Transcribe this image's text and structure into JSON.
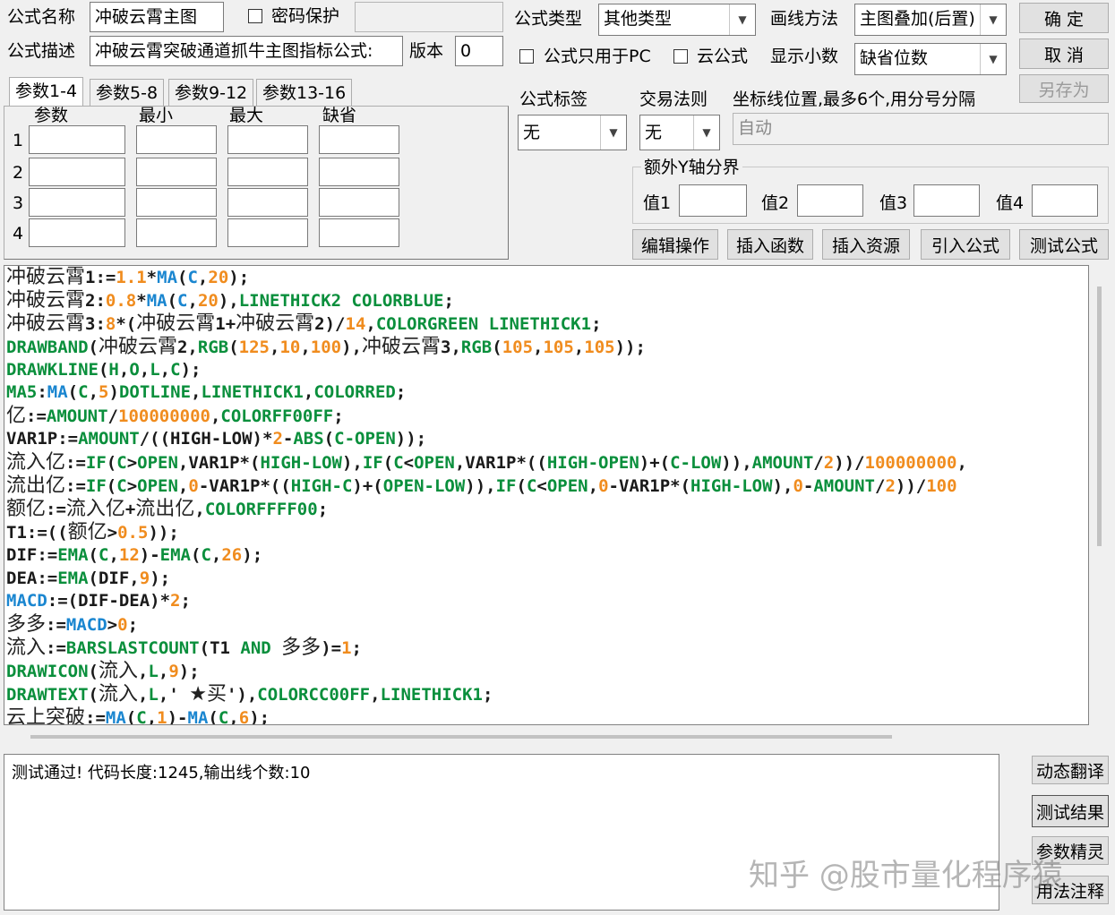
{
  "header": {
    "name_label": "公式名称",
    "name_value": "冲破云霄主图",
    "password_label": "密码保护",
    "desc_label": "公式描述",
    "desc_value": "冲破云霄突破通道抓牛主图指标公式:",
    "version_label": "版本",
    "version_value": "0",
    "type_label": "公式类型",
    "type_value": "其他类型",
    "draw_label": "画线方法",
    "draw_value": "主图叠加(后置)",
    "pc_only_label": "公式只用于PC",
    "cloud_label": "云公式",
    "decimal_label": "显示小数",
    "decimal_value": "缺省位数"
  },
  "buttons": {
    "ok": "确 定",
    "cancel": "取 消",
    "save_as": "另存为",
    "edit_ops": "编辑操作",
    "insert_func": "插入函数",
    "insert_res": "插入资源",
    "import_formula": "引入公式",
    "test_formula": "测试公式",
    "dynamic_translate": "动态翻译",
    "test_result": "测试结果",
    "param_wizard": "参数精灵",
    "usage_notes": "用法注释"
  },
  "tabs": [
    "参数1-4",
    "参数5-8",
    "参数9-12",
    "参数13-16"
  ],
  "params": {
    "headers": [
      "参数",
      "最小",
      "最大",
      "缺省"
    ],
    "rows": [
      "1",
      "2",
      "3",
      "4"
    ]
  },
  "right_panel": {
    "tag_label": "公式标签",
    "tag_value": "无",
    "rule_label": "交易法则",
    "rule_value": "无",
    "coord_label": "坐标线位置,最多6个,用分号分隔",
    "coord_value": "自动",
    "y_axis_label": "额外Y轴分界",
    "v1": "值1",
    "v2": "值2",
    "v3": "值3",
    "v4": "值4"
  },
  "code_lines": [
    [
      [
        "cc",
        "冲破云霄"
      ],
      [
        "co",
        "1:="
      ],
      [
        "cn",
        "1.1"
      ],
      [
        "co",
        "*"
      ],
      [
        "cf",
        "MA"
      ],
      [
        "co",
        "("
      ],
      [
        "cf",
        "C"
      ],
      [
        "co",
        ","
      ],
      [
        "cn",
        "20"
      ],
      [
        "co",
        ");"
      ]
    ],
    [
      [
        "cc",
        "冲破云霄"
      ],
      [
        "co",
        "2:"
      ],
      [
        "cn",
        "0.8"
      ],
      [
        "co",
        "*"
      ],
      [
        "cf",
        "MA"
      ],
      [
        "co",
        "("
      ],
      [
        "cf",
        "C"
      ],
      [
        "co",
        ","
      ],
      [
        "cn",
        "20"
      ],
      [
        "co",
        "),"
      ],
      [
        "ck",
        "LINETHICK2 COLORBLUE"
      ],
      [
        "co",
        ";"
      ]
    ],
    [
      [
        "cc",
        "冲破云霄"
      ],
      [
        "co",
        "3:"
      ],
      [
        "cn",
        "8"
      ],
      [
        "co",
        "*("
      ],
      [
        "cc",
        "冲破云霄"
      ],
      [
        "co",
        "1+"
      ],
      [
        "cc",
        "冲破云霄"
      ],
      [
        "co",
        "2)/"
      ],
      [
        "cn",
        "14"
      ],
      [
        "co",
        ","
      ],
      [
        "ck",
        "COLORGREEN LINETHICK1"
      ],
      [
        "co",
        ";"
      ]
    ],
    [
      [
        "ck",
        "DRAWBAND"
      ],
      [
        "co",
        "("
      ],
      [
        "cc",
        "冲破云霄"
      ],
      [
        "co",
        "2,"
      ],
      [
        "ck",
        "RGB"
      ],
      [
        "co",
        "("
      ],
      [
        "cn",
        "125"
      ],
      [
        "co",
        ","
      ],
      [
        "cn",
        "10"
      ],
      [
        "co",
        ","
      ],
      [
        "cn",
        "100"
      ],
      [
        "co",
        "),"
      ],
      [
        "cc",
        "冲破云霄"
      ],
      [
        "co",
        "3,"
      ],
      [
        "ck",
        "RGB"
      ],
      [
        "co",
        "("
      ],
      [
        "cn",
        "105"
      ],
      [
        "co",
        ","
      ],
      [
        "cn",
        "105"
      ],
      [
        "co",
        ","
      ],
      [
        "cn",
        "105"
      ],
      [
        "co",
        "));"
      ]
    ],
    [
      [
        "ck",
        "DRAWKLINE"
      ],
      [
        "co",
        "("
      ],
      [
        "ck",
        "H"
      ],
      [
        "co",
        ","
      ],
      [
        "ck",
        "O"
      ],
      [
        "co",
        ","
      ],
      [
        "ck",
        "L"
      ],
      [
        "co",
        ","
      ],
      [
        "ck",
        "C"
      ],
      [
        "co",
        ");"
      ]
    ],
    [
      [
        "ck",
        "MA5"
      ],
      [
        "co",
        ":"
      ],
      [
        "cf",
        "MA"
      ],
      [
        "co",
        "("
      ],
      [
        "ck",
        "C"
      ],
      [
        "co",
        ","
      ],
      [
        "cn",
        "5"
      ],
      [
        "co",
        ")"
      ],
      [
        "ck",
        "DOTLINE"
      ],
      [
        "co",
        ","
      ],
      [
        "ck",
        "LINETHICK1"
      ],
      [
        "co",
        ","
      ],
      [
        "ck",
        "COLORRED"
      ],
      [
        "co",
        ";"
      ]
    ],
    [
      [
        "cc",
        "亿"
      ],
      [
        "co",
        ":="
      ],
      [
        "ck",
        "AMOUNT"
      ],
      [
        "co",
        "/"
      ],
      [
        "cn",
        "100000000"
      ],
      [
        "co",
        ","
      ],
      [
        "ck",
        "COLORFF00FF"
      ],
      [
        "co",
        ";"
      ]
    ],
    [
      [
        "co",
        "VAR1P:="
      ],
      [
        "ck",
        "AMOUNT"
      ],
      [
        "co",
        "/((HIGH-LOW)*"
      ],
      [
        "cn",
        "2"
      ],
      [
        "co",
        "-"
      ],
      [
        "ck",
        "ABS"
      ],
      [
        "co",
        "("
      ],
      [
        "ck",
        "C-OPEN"
      ],
      [
        "co",
        "));"
      ]
    ],
    [
      [
        "cc",
        "流入亿"
      ],
      [
        "co",
        ":="
      ],
      [
        "ck",
        "IF"
      ],
      [
        "co",
        "("
      ],
      [
        "ck",
        "C"
      ],
      [
        "co",
        ">"
      ],
      [
        "ck",
        "OPEN"
      ],
      [
        "co",
        ",VAR1P*("
      ],
      [
        "ck",
        "HIGH-LOW"
      ],
      [
        "co",
        "),"
      ],
      [
        "ck",
        "IF"
      ],
      [
        "co",
        "("
      ],
      [
        "ck",
        "C"
      ],
      [
        "co",
        "<"
      ],
      [
        "ck",
        "OPEN"
      ],
      [
        "co",
        ",VAR1P*(("
      ],
      [
        "ck",
        "HIGH-OPEN"
      ],
      [
        "co",
        ")+("
      ],
      [
        "ck",
        "C-LOW"
      ],
      [
        "co",
        "))"
      ],
      [
        "co",
        ","
      ],
      [
        "ck",
        "AMOUNT"
      ],
      [
        "co",
        "/"
      ],
      [
        "cn",
        "2"
      ],
      [
        "co",
        "))/"
      ],
      [
        "cn",
        "100000000"
      ],
      [
        "co",
        ","
      ]
    ],
    [
      [
        "cc",
        "流出亿"
      ],
      [
        "co",
        ":="
      ],
      [
        "ck",
        "IF"
      ],
      [
        "co",
        "("
      ],
      [
        "ck",
        "C"
      ],
      [
        "co",
        ">"
      ],
      [
        "ck",
        "OPEN"
      ],
      [
        "co",
        ","
      ],
      [
        "cn",
        "0"
      ],
      [
        "co",
        "-VAR1P*(("
      ],
      [
        "ck",
        "HIGH-C"
      ],
      [
        "co",
        ")+("
      ],
      [
        "ck",
        "OPEN-LOW"
      ],
      [
        "co",
        "))"
      ],
      [
        "co",
        ","
      ],
      [
        "ck",
        "IF"
      ],
      [
        "co",
        "("
      ],
      [
        "ck",
        "C"
      ],
      [
        "co",
        "<"
      ],
      [
        "ck",
        "OPEN"
      ],
      [
        "co",
        ","
      ],
      [
        "cn",
        "0"
      ],
      [
        "co",
        "-VAR1P*("
      ],
      [
        "ck",
        "HIGH-LOW"
      ],
      [
        "co",
        "),"
      ],
      [
        "cn",
        "0"
      ],
      [
        "co",
        "-"
      ],
      [
        "ck",
        "AMOUNT"
      ],
      [
        "co",
        "/"
      ],
      [
        "cn",
        "2"
      ],
      [
        "co",
        "))/"
      ],
      [
        "cn",
        "100"
      ]
    ],
    [
      [
        "cc",
        "额亿"
      ],
      [
        "co",
        ":="
      ],
      [
        "cc",
        "流入亿"
      ],
      [
        "co",
        "+"
      ],
      [
        "cc",
        "流出亿"
      ],
      [
        "co",
        ","
      ],
      [
        "ck",
        "COLORFFFF00"
      ],
      [
        "co",
        ";"
      ]
    ],
    [
      [
        "co",
        "T1:=(("
      ],
      [
        "cc",
        "额亿"
      ],
      [
        "co",
        ">"
      ],
      [
        "cn",
        "0.5"
      ],
      [
        "co",
        "));"
      ]
    ],
    [
      [
        "co",
        "DIF:="
      ],
      [
        "ck",
        "EMA"
      ],
      [
        "co",
        "("
      ],
      [
        "ck",
        "C"
      ],
      [
        "co",
        ","
      ],
      [
        "cn",
        "12"
      ],
      [
        "co",
        ")-"
      ],
      [
        "ck",
        "EMA"
      ],
      [
        "co",
        "("
      ],
      [
        "ck",
        "C"
      ],
      [
        "co",
        ","
      ],
      [
        "cn",
        "26"
      ],
      [
        "co",
        ");"
      ]
    ],
    [
      [
        "co",
        "DEA:="
      ],
      [
        "ck",
        "EMA"
      ],
      [
        "co",
        "(DIF,"
      ],
      [
        "cn",
        "9"
      ],
      [
        "co",
        ");"
      ]
    ],
    [
      [
        "cf",
        "MACD"
      ],
      [
        "co",
        ":=(DIF-DEA)*"
      ],
      [
        "cn",
        "2"
      ],
      [
        "co",
        ";"
      ]
    ],
    [
      [
        "cc",
        "多多"
      ],
      [
        "co",
        ":="
      ],
      [
        "cf",
        "MACD"
      ],
      [
        "co",
        ">"
      ],
      [
        "cn",
        "0"
      ],
      [
        "co",
        ";"
      ]
    ],
    [
      [
        "cc",
        "流入"
      ],
      [
        "co",
        ":="
      ],
      [
        "ck",
        "BARSLASTCOUNT"
      ],
      [
        "co",
        "(T1 "
      ],
      [
        "ck",
        "AND"
      ],
      [
        "co",
        " "
      ],
      [
        "cc",
        "多多"
      ],
      [
        "co",
        ")="
      ],
      [
        "cn",
        "1"
      ],
      [
        "co",
        ";"
      ]
    ],
    [
      [
        "ck",
        "DRAWICON"
      ],
      [
        "co",
        "("
      ],
      [
        "cc",
        "流入"
      ],
      [
        "co",
        ","
      ],
      [
        "ck",
        "L"
      ],
      [
        "co",
        ","
      ],
      [
        "cn",
        "9"
      ],
      [
        "co",
        ");"
      ]
    ],
    [
      [
        "ck",
        "DRAWTEXT"
      ],
      [
        "co",
        "("
      ],
      [
        "cc",
        "流入"
      ],
      [
        "co",
        ","
      ],
      [
        "ck",
        "L"
      ],
      [
        "co",
        ",' "
      ],
      [
        "cc",
        "★买"
      ],
      [
        "co",
        "'),"
      ],
      [
        "ck",
        "COLORCC00FF"
      ],
      [
        "co",
        ","
      ],
      [
        "ck",
        "LINETHICK1"
      ],
      [
        "co",
        ";"
      ]
    ],
    [
      [
        "cc",
        "云上突破"
      ],
      [
        "co",
        ":="
      ],
      [
        "cf",
        "MA"
      ],
      [
        "co",
        "("
      ],
      [
        "ck",
        "C"
      ],
      [
        "co",
        ","
      ],
      [
        "cn",
        "1"
      ],
      [
        "co",
        ")-"
      ],
      [
        "cf",
        "MA"
      ],
      [
        "co",
        "("
      ],
      [
        "ck",
        "C"
      ],
      [
        "co",
        ","
      ],
      [
        "cn",
        "6"
      ],
      [
        "co",
        ");"
      ]
    ]
  ],
  "status_message": "测试通过! 代码长度:1245,输出线个数:10",
  "watermark": "知乎 @股市量化程序猿"
}
